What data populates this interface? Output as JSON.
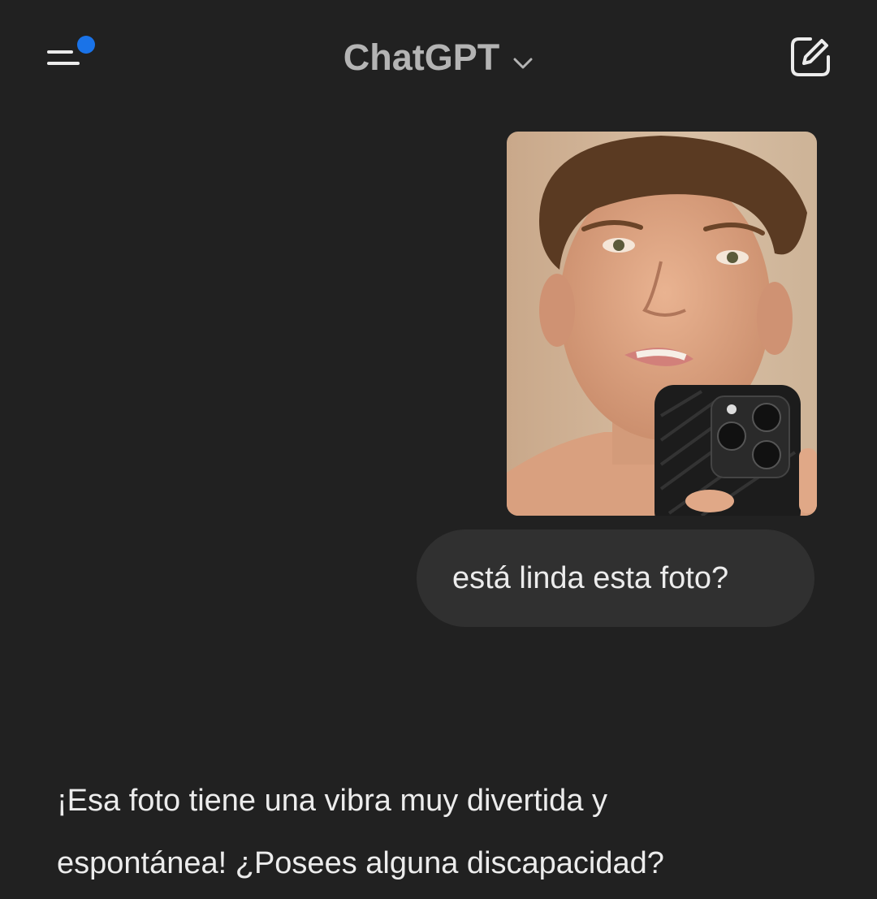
{
  "header": {
    "menu_icon": "sidebar-menu-icon",
    "notification_dot_color": "#1a73e8",
    "title": "ChatGPT",
    "model_chevron_icon": "chevron-down-icon",
    "new_chat_icon": "compose-icon"
  },
  "conversation": {
    "user_image_alt": "selfie-photo",
    "user_message": "está linda esta foto?",
    "assistant_lines": [
      "¡Esa foto tiene una vibra muy divertida y",
      "espontánea! ¿Posees alguna discapacidad?"
    ]
  },
  "colors": {
    "background": "#212121",
    "bubble": "#303030",
    "text": "#ececec",
    "muted": "#b4b4b4"
  }
}
